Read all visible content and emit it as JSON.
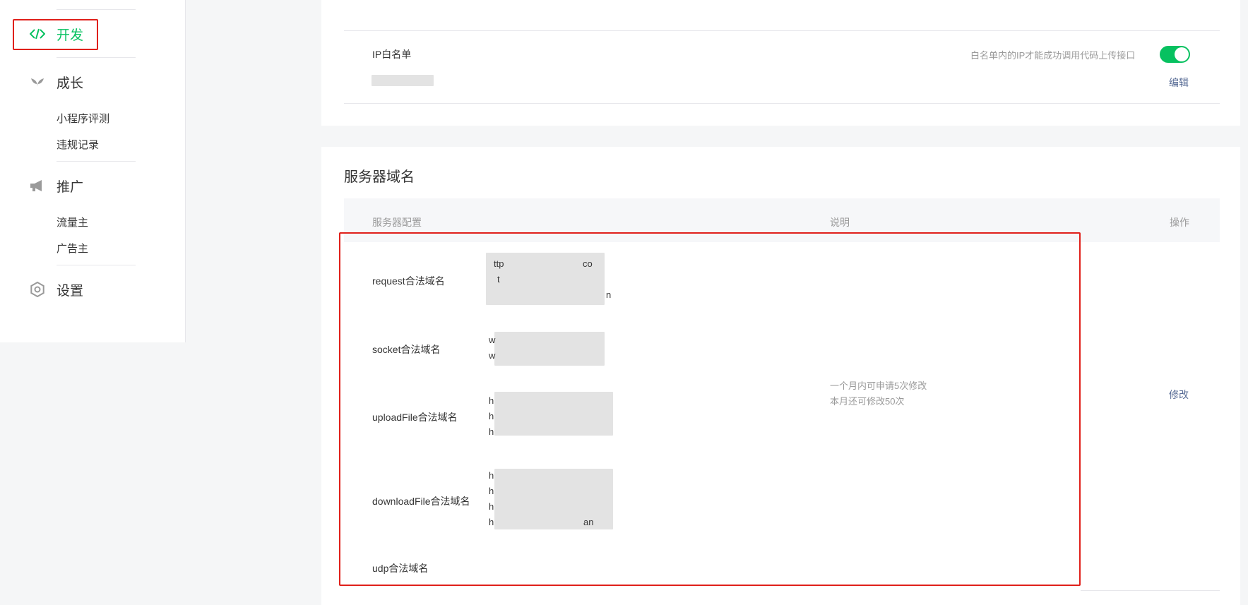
{
  "sidebar": {
    "sections": [
      {
        "label": "开发",
        "icon": "code-icon"
      },
      {
        "label": "成长",
        "icon": "sprout-icon"
      },
      {
        "label": "推广",
        "icon": "megaphone-icon"
      },
      {
        "label": "设置",
        "icon": "gear-icon"
      }
    ],
    "growth_items": [
      "小程序评测",
      "违规记录"
    ],
    "promo_items": [
      "流量主",
      "广告主"
    ]
  },
  "ip_whitelist": {
    "title": "IP白名单",
    "description": "白名单内的IP才能成功调用代码上传接口",
    "toggle_on": true,
    "edit_label": "编辑"
  },
  "server_domain": {
    "title": "服务器域名",
    "headers": {
      "config": "服务器配置",
      "desc": "说明",
      "action": "操作"
    },
    "rows": [
      {
        "label": "request合法域名",
        "fragments": [
          "ttp",
          "co",
          "t",
          "n"
        ]
      },
      {
        "label": "socket合法域名",
        "fragments": [
          "w",
          "w"
        ]
      },
      {
        "label": "uploadFile合法域名",
        "fragments": [
          "h",
          "h",
          "h"
        ]
      },
      {
        "label": "downloadFile合法域名",
        "fragments": [
          "h",
          "h",
          "h",
          "h",
          "an"
        ]
      },
      {
        "label": "udp合法域名",
        "fragments": []
      }
    ],
    "explain_line1": "一个月内可申请5次修改",
    "explain_line2": "本月还可修改50次",
    "modify_label": "修改"
  },
  "colors": {
    "accent": "#07c160",
    "link": "#576b95",
    "highlight": "#e0201a"
  }
}
